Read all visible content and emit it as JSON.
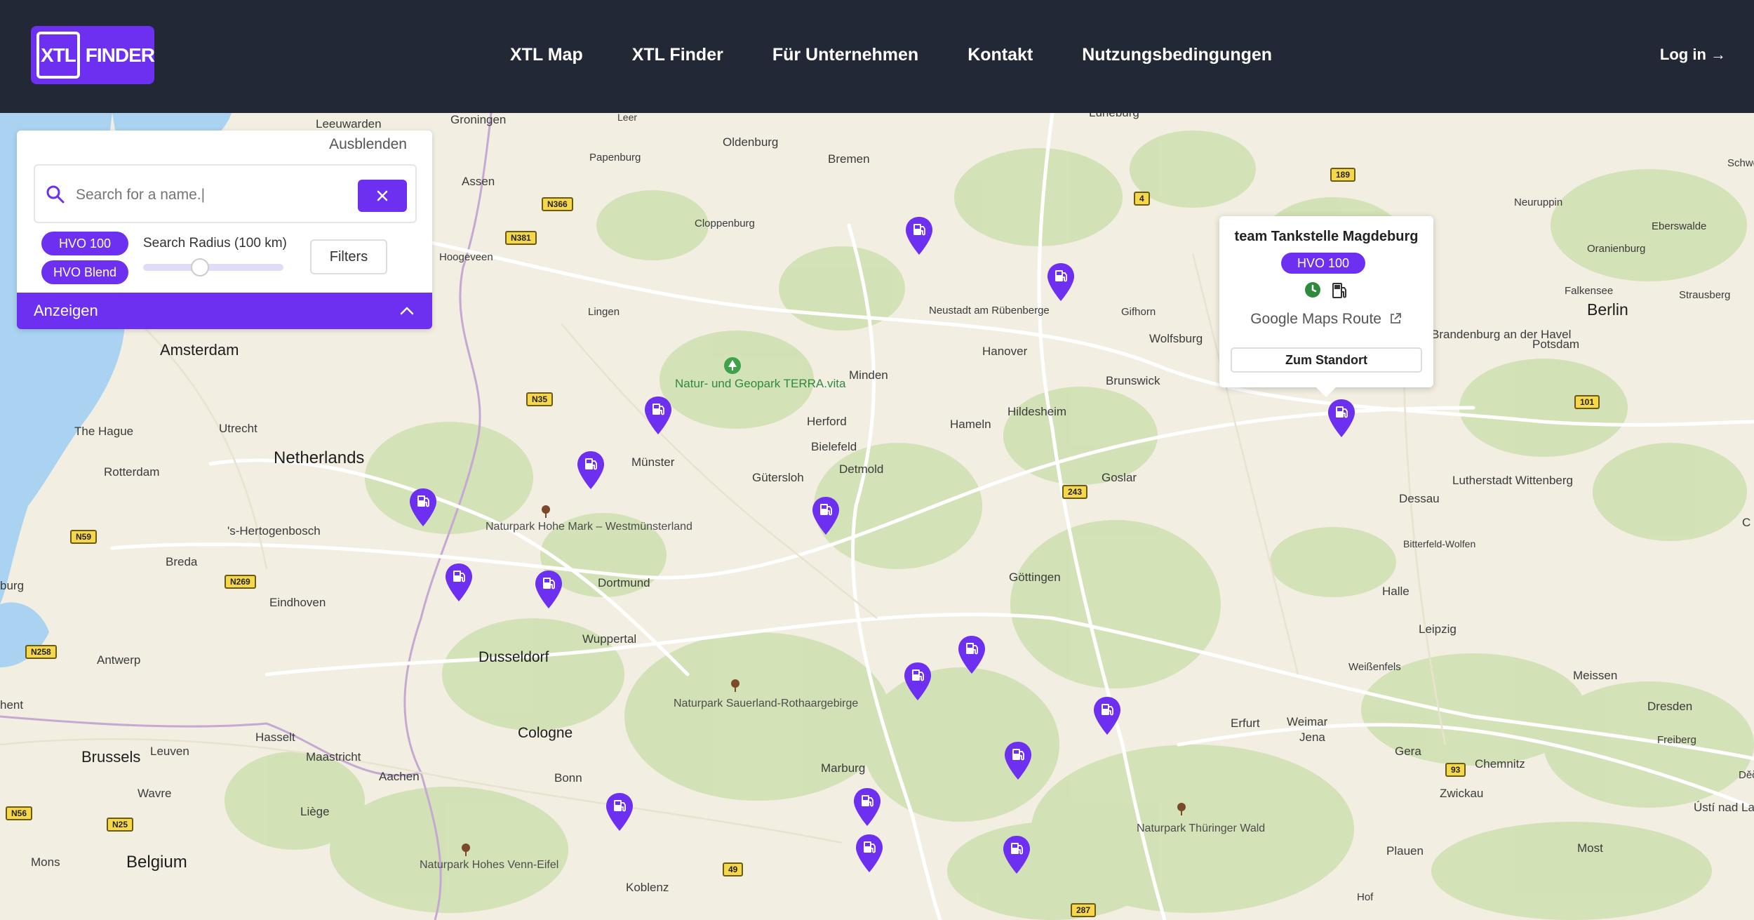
{
  "header": {
    "logo_box": "XTL",
    "logo_text": "FINDER",
    "nav": [
      "XTL Map",
      "XTL Finder",
      "Für Unternehmen",
      "Kontakt",
      "Nutzungsbedingungen"
    ],
    "login": "Log in →"
  },
  "panel": {
    "hide": "Ausblenden",
    "search_placeholder": "Search for a name.|",
    "chips": [
      "HVO 100",
      "HVO Blend"
    ],
    "radius_label": "Search Radius (100 km)",
    "radius_value_km": 100,
    "filters": "Filters",
    "show": "Anzeigen"
  },
  "popup": {
    "title": "team Tankstelle Magdeburg",
    "fuel": "HVO 100",
    "route": "Google Maps Route",
    "button": "Zum Standort"
  },
  "map": {
    "cities": {
      "leeuwarden": "Leeuwarden",
      "groningen": "Groningen",
      "leer": "Leer",
      "oldenburg": "Oldenburg",
      "bremen": "Bremen",
      "papenburg": "Papenburg",
      "assen": "Assen",
      "hoogeveen": "Hoogeveen",
      "cloppenburg": "Cloppenburg",
      "lingen": "Lingen",
      "neustadt": "Neustadt am Rübenberge",
      "gifhorn": "Gifhorn",
      "wolfsburg": "Wolfsburg",
      "hanover": "Hanover",
      "minden": "Minden",
      "naturpark_terra": "Natur- und Geopark TERRA.vita",
      "amsterdam": "Amsterdam",
      "the_hague": "The Hague",
      "utrecht": "Utrecht",
      "netherlands": "Netherlands",
      "rotterdam": "Rotterdam",
      "herford": "Herford",
      "bielefeld": "Bielefeld",
      "hameln": "Hameln",
      "hildesheim": "Hildesheim",
      "brunswick": "Brunswick",
      "munster": "Münster",
      "gutersloh": "Gütersloh",
      "detmold": "Detmold",
      "goslar": "Goslar",
      "hohe_mark": "Naturpark Hohe Mark – Westmünsterland",
      "hertogenbosch": "'s-Hertogenbosch",
      "breda": "Breda",
      "eindhoven": "Eindhoven",
      "dortmund": "Dortmund",
      "wuppertal": "Wuppertal",
      "dusseldorf": "Dusseldorf",
      "antwerp": "Antwerp",
      "gottingen": "Göttingen",
      "dessau": "Dessau",
      "lutherstadt": "Lutherstadt Wittenberg",
      "bitterfeld": "Bitterfeld-Wolfen",
      "halle": "Halle",
      "leipzig": "Leipzig",
      "weissenfels": "Weißenfels",
      "sauerland": "Naturpark Sauerland-Rothaargebirge",
      "cologne": "Cologne",
      "brussels": "Brussels",
      "leuven": "Leuven",
      "hasselt": "Hasselt",
      "maastricht": "Maastricht",
      "aachen": "Aachen",
      "wavre": "Wavre",
      "liege": "Liège",
      "bonn": "Bonn",
      "marburg": "Marburg",
      "erfurt": "Erfurt",
      "weimar": "Weimar",
      "jena": "Jena",
      "gera": "Gera",
      "chemnitz": "Chemnitz",
      "zwickau": "Zwickau",
      "meissen": "Meissen",
      "dresden": "Dresden",
      "freiberg": "Freiberg",
      "thuringer": "Naturpark Thüringer Wald",
      "plauen": "Plauen",
      "hof": "Hof",
      "most": "Most",
      "usti": "Ústí nad Labem",
      "koblenz": "Koblenz",
      "hohes_venn": "Naturpark Hohes Venn-Eifel",
      "mons": "Mons",
      "belgium": "Belgium",
      "berlin": "Berlin",
      "potsdam": "Potsdam",
      "brandenburg": "Brandenburg an der Havel",
      "falkensee": "Falkensee",
      "oranienburg": "Oranienburg",
      "eberswalde": "Eberswalde",
      "strausberg": "Strausberg",
      "neuruppin": "Neuruppin",
      "luneburg": "Lüneburg",
      "schwe": "Schwe",
      "burg": "burg",
      "hent": "hent",
      "dec": "Děči",
      "c_edge": "C"
    },
    "roads": {
      "n366": "N366",
      "n381": "N381",
      "n35": "N35",
      "n59": "N59",
      "n269": "N269",
      "n258": "N258",
      "n56": "N56",
      "n25": "N25",
      "b4": "4",
      "b189": "189",
      "b243": "243",
      "b101": "101",
      "b93": "93",
      "b49": "49",
      "b287": "287"
    }
  },
  "colors": {
    "brand": "#6d2ff0",
    "navbar": "#222836",
    "map_bg": "#f2eee2",
    "forest": "#cfe0b2",
    "water": "#a9d3f0"
  }
}
